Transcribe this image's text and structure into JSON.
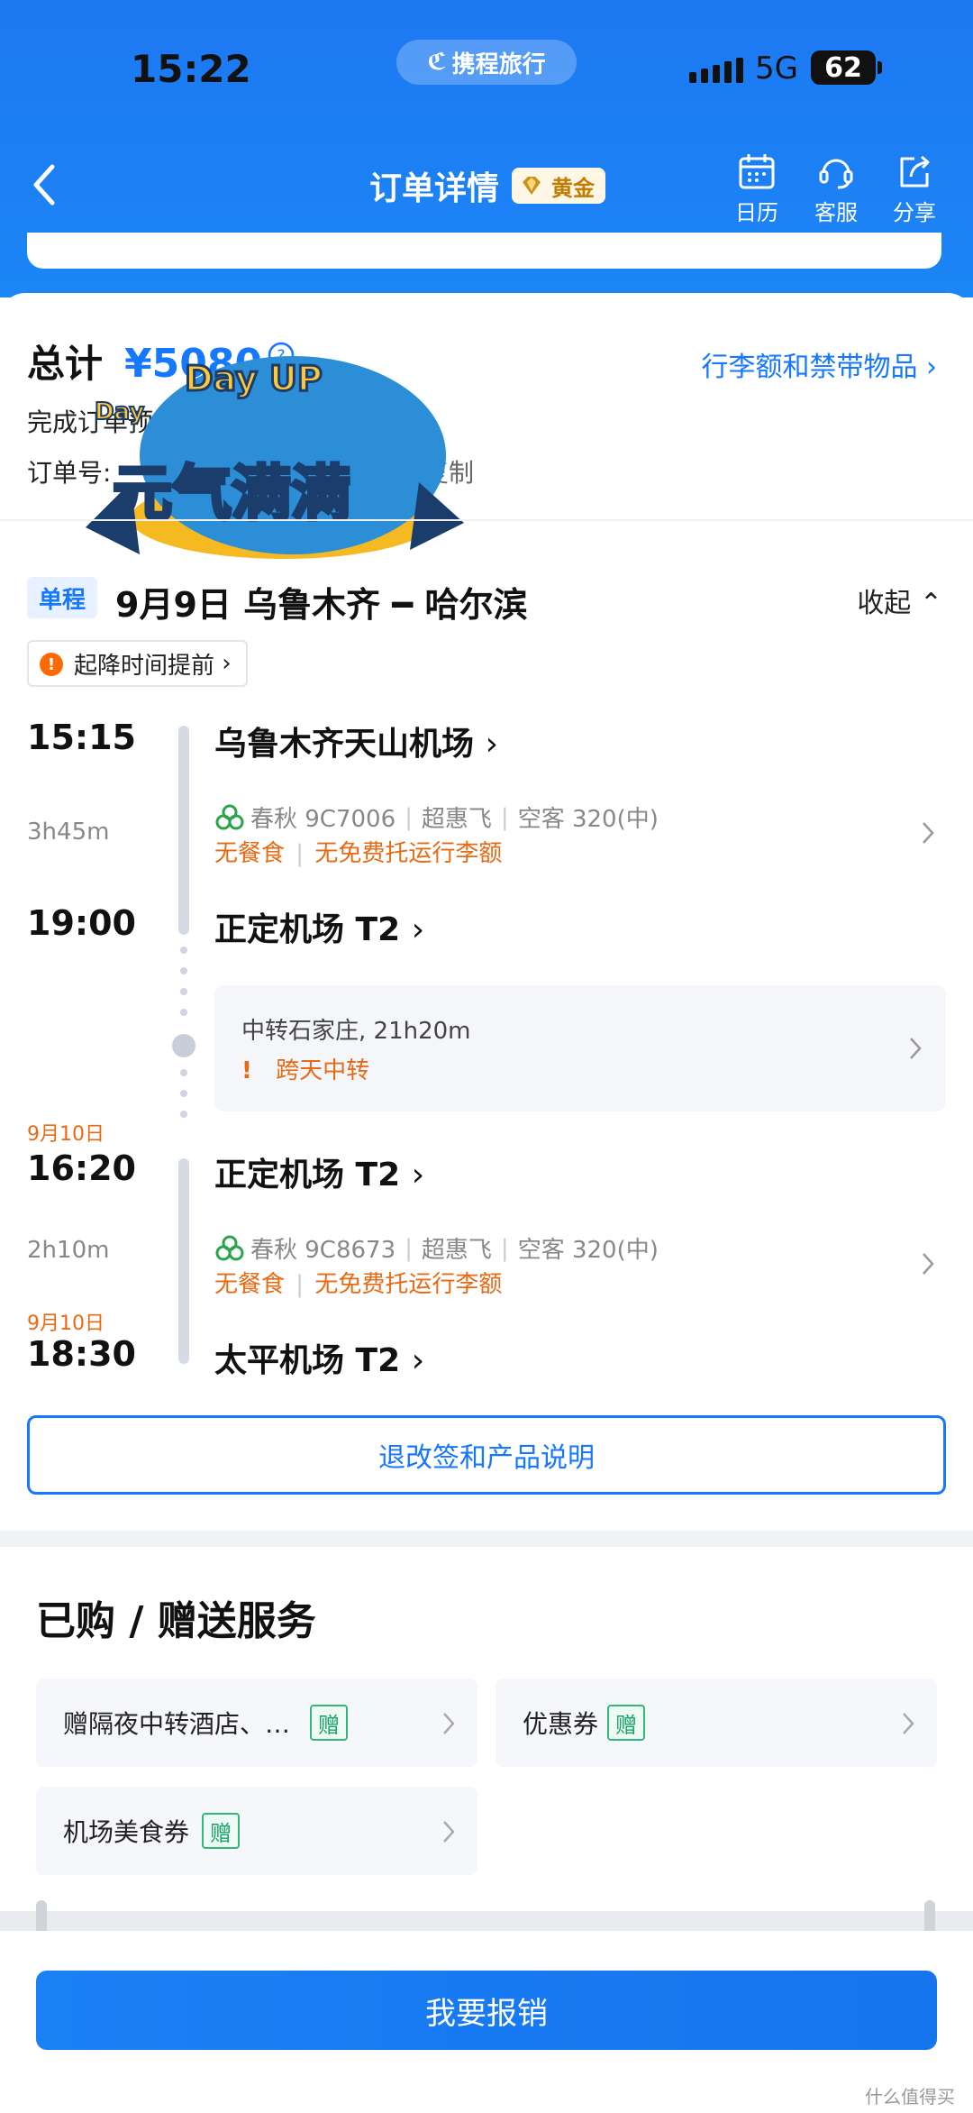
{
  "status_bar": {
    "time": "15:22",
    "brand": "携程旅行",
    "network": "5G",
    "battery": "62"
  },
  "header": {
    "title": "订单详情",
    "member_badge": "黄金",
    "actions": [
      {
        "label": "日历",
        "icon": "calendar-icon"
      },
      {
        "label": "客服",
        "icon": "headset-icon"
      },
      {
        "label": "分享",
        "icon": "share-icon"
      }
    ]
  },
  "summary": {
    "total_label": "总计",
    "total_amount": "¥5080",
    "baggage_link": "行李额和禁带物品",
    "order_status": "完成订单预",
    "order_no_label": "订单号:",
    "copy_label": "复制"
  },
  "trip": {
    "type": "单程",
    "title": "9月9日 乌鲁木齐 ━ 哈尔滨",
    "collapse_label": "收起",
    "notice": "起降时间提前",
    "legs": [
      {
        "dep_time": "15:15",
        "dep_airport": "乌鲁木齐天山机场",
        "duration": "3h45m",
        "airline": "春秋 9C7006",
        "fare": "超惠飞",
        "aircraft": "空客 320(中)",
        "meal": "无餐食",
        "baggage": "无免费托运行李额",
        "arr_time": "19:00",
        "arr_airport": "正定机场 T2"
      },
      {
        "dep_date": "9月10日",
        "dep_time": "16:20",
        "dep_airport": "正定机场 T2",
        "duration": "2h10m",
        "airline": "春秋 9C8673",
        "fare": "超惠飞",
        "aircraft": "空客 320(中)",
        "meal": "无餐食",
        "baggage": "无免费托运行李额",
        "arr_date": "9月10日",
        "arr_time": "18:30",
        "arr_airport": "太平机场 T2"
      }
    ],
    "transfer": {
      "text": "中转石家庄, 21h20m",
      "warning": "跨天中转"
    }
  },
  "refund_button": "退改签和产品说明",
  "services": {
    "title": "已购 / 赠送服务",
    "gift_label": "赠",
    "items": [
      {
        "label": "赠隔夜中转酒店、…"
      },
      {
        "label": "优惠券"
      },
      {
        "label": "机场美食券"
      }
    ]
  },
  "reimburse_button": "我要报销",
  "watermark": "什么值得买",
  "sticker": {
    "line1": "Day UP",
    "line2": "Day",
    "line3": "元气满满"
  },
  "colors": {
    "primary": "#1677ff",
    "header": "#1b7ff4",
    "warning": "#e86a14",
    "gift": "#1aa36a"
  }
}
